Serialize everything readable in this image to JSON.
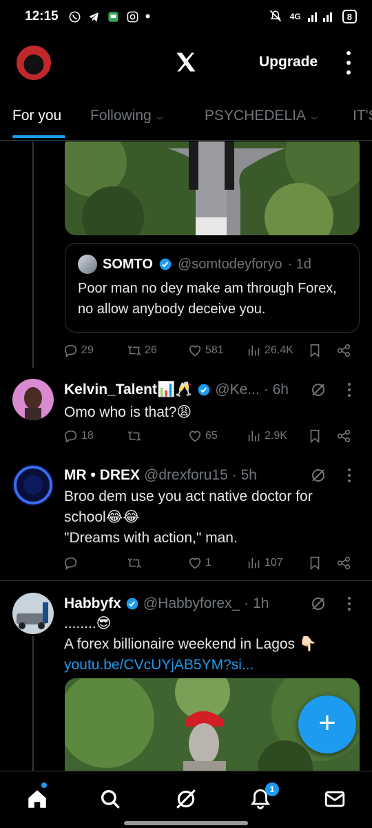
{
  "status_bar": {
    "time": "12:15",
    "notification_icons": [
      "whatsapp-icon",
      "telegram-icon",
      "chat-icon",
      "instagram-icon"
    ],
    "dot": "•",
    "network": "4G",
    "battery": "8"
  },
  "header": {
    "logo": "X",
    "upgrade_label": "Upgrade"
  },
  "tabs": [
    {
      "label": "For you",
      "active": true
    },
    {
      "label": "Following",
      "has_dropdown": true
    },
    {
      "label": "PSYCHEDELIA",
      "has_dropdown": true
    },
    {
      "label": "IT'S"
    }
  ],
  "quote": {
    "name": "SOMTO",
    "handle": "@somtodeyforyo",
    "time": "· 1d",
    "text": "Poor man no dey make am through Forex, no allow anybody deceive you."
  },
  "tweets": [
    {
      "actions": {
        "replies": "29",
        "retweets": "26",
        "likes": "581",
        "views": "26.4K"
      }
    },
    {
      "name": "Kelvin_Talent📊🥂",
      "handle": "@Ke...",
      "time": "· 6h",
      "text": "Omo who is that?😩",
      "actions": {
        "replies": "18",
        "retweets": "",
        "likes": "65",
        "views": "2.9K"
      }
    },
    {
      "name": "MR • DREX",
      "handle": "@drexforu15",
      "time": "· 5h",
      "text_lines": [
        "Broo dem use you act native doctor for school😂😂",
        "\"Dreams with action,\" man."
      ],
      "actions": {
        "replies": "",
        "retweets": "",
        "likes": "1",
        "views": "107"
      }
    },
    {
      "name": "Habbyfx",
      "handle": "@Habbyforex_",
      "time": "· 1h",
      "text_lines": [
        "........😎",
        "A forex billionaire weekend in Lagos 👇🏻"
      ],
      "link": "youtu.be/CVcUYjAB5YM?si..."
    }
  ],
  "bottom_nav": {
    "items": [
      "home-icon",
      "search-icon",
      "grok-icon",
      "bell-icon",
      "mail-icon"
    ],
    "notification_count": "1"
  },
  "colors": {
    "accent": "#1d9bf0",
    "muted": "#71767b",
    "divider": "#2f3336",
    "background": "#000000"
  }
}
